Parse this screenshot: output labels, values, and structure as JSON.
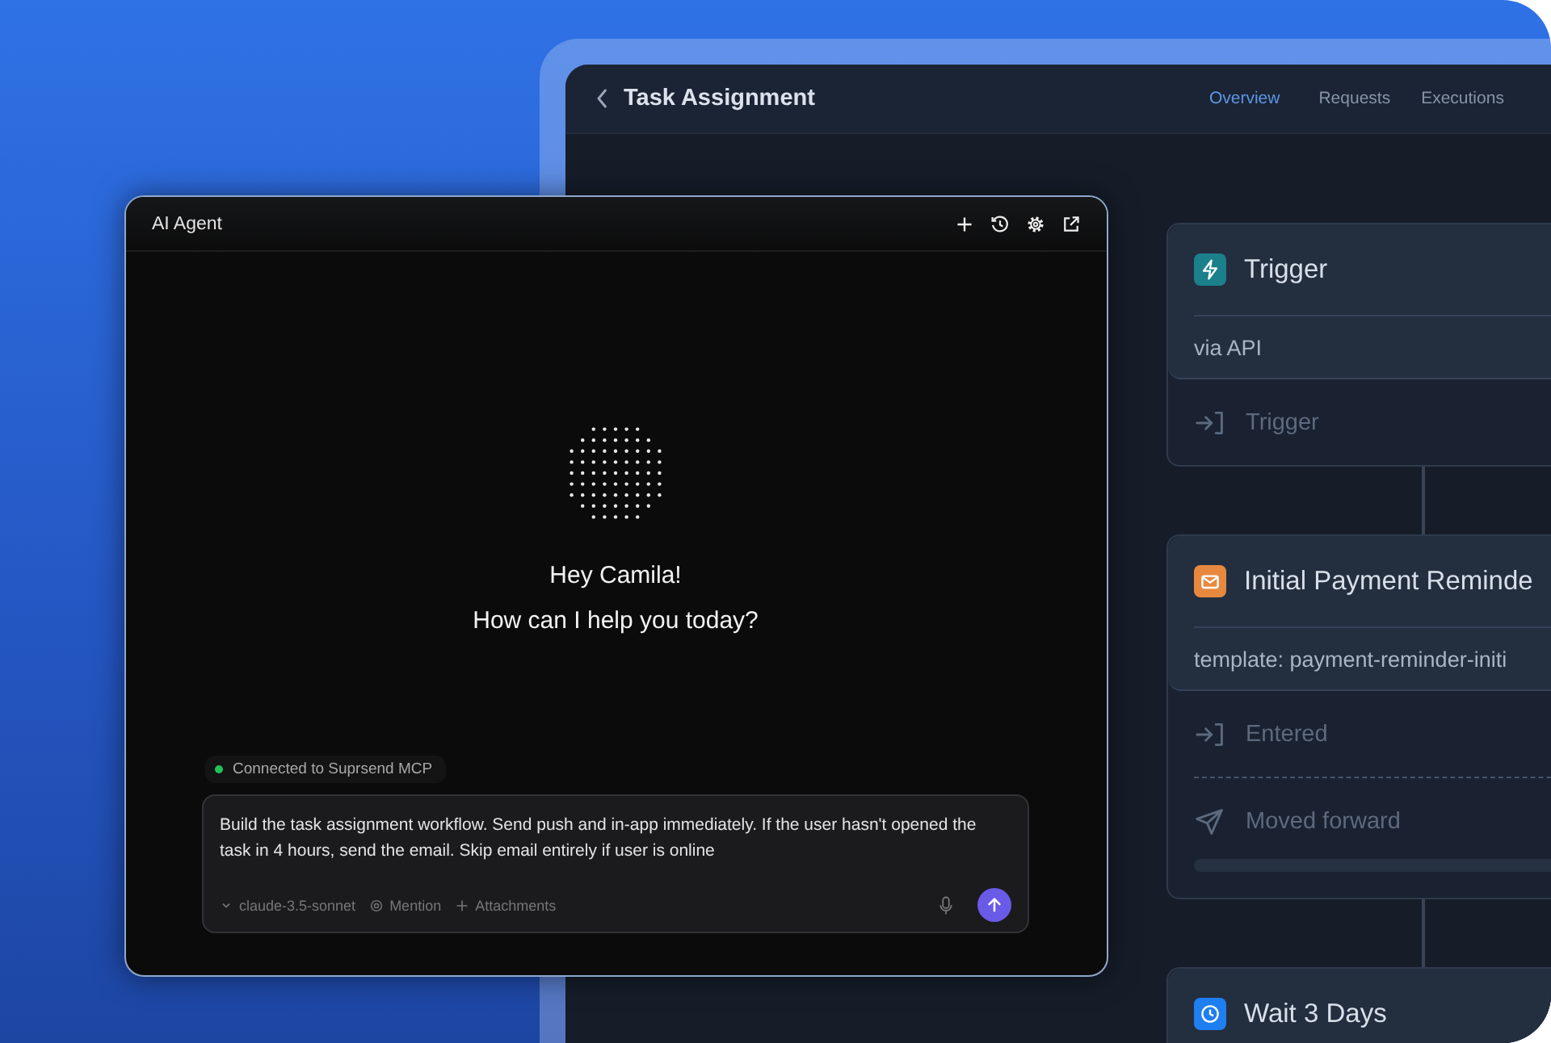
{
  "workflow": {
    "title": "Task Assignment",
    "tabs": [
      {
        "label": "Overview",
        "selected": true
      },
      {
        "label": "Requests",
        "selected": false
      },
      {
        "label": "Executions",
        "selected": false
      }
    ],
    "nodes": [
      {
        "kind": "trigger",
        "color": "#1b7f8c",
        "title": "Trigger",
        "subtitle": "via API",
        "rows": [
          {
            "kind": "entered",
            "label": "Trigger"
          }
        ]
      },
      {
        "kind": "email",
        "color": "#e8883e",
        "title": "Initial Payment Reminde",
        "subtitle": "template: payment-reminder-initi",
        "rows": [
          {
            "kind": "entered",
            "label": "Entered"
          },
          {
            "kind": "forwarded",
            "label": "Moved forward"
          }
        ]
      },
      {
        "kind": "wait",
        "color": "#1f7ef0",
        "title": "Wait 3 Days"
      }
    ]
  },
  "agent": {
    "title": "AI Agent",
    "greeting": "Hey Camila!",
    "prompt": "How can I help you today?",
    "connection": {
      "label": "Connected to Suprsend MCP",
      "connected": true
    },
    "input": {
      "value": "Build the task assignment workflow. Send push and in-app immediately. If the user hasn't opened the task in 4 hours, send the email. Skip email entirely if user is online"
    },
    "model": "claude-3.5-sonnet",
    "actions": [
      {
        "kind": "mention",
        "label": "Mention"
      },
      {
        "kind": "attach",
        "label": "Attachments"
      }
    ]
  }
}
